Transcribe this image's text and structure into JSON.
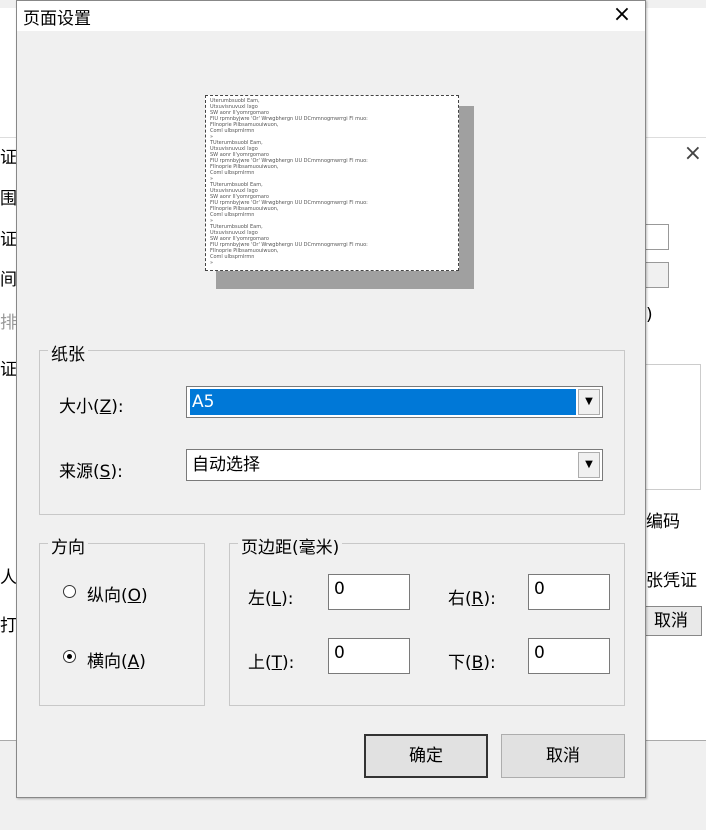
{
  "background_window": {
    "left_fragments": [
      "证",
      "围",
      "证",
      "间",
      "排",
      "证",
      "人",
      "打"
    ],
    "right_fragments": [
      ")",
      "编码",
      "张凭证"
    ],
    "cancel_label": "取消",
    "close_glyph": "×"
  },
  "dialog": {
    "title": "页面设置",
    "close_glyph": "×",
    "preview": {
      "lines": [
        "Uterumbsuobl Eam,",
        "Utxuvisnuvuxl Ixgo",
        "SW aonr Il'yomrgomaro",
        "FIU rpmnbyjwre 'Or' Wrwgbhergn UU DCmmnogmwrrgi Fl muo:",
        "FIlnoprie Pilbsamuouiwuon,",
        "Coml ulbsprnlrmn",
        "»",
        "TUterumbsuobl Eam,",
        "Utxuvisnuvuxl Ixgo",
        "SW aonr Il'yomrgomaro",
        "FIU rpmnbyjwre 'Or' Wrwgbhergn UU DCmmnogmwrrgi Fl muo:",
        "FIlnoprie Pilbsamuouiwuon,",
        "Coml ulbsprnlrmn",
        "»",
        "TUterumbsuobl Eam,",
        "Utxuvisnuvuxl Ixgo",
        "SW aonr Il'yomrgomaro",
        "FIU rpmnbyjwre 'Or' Wrwgbhergn UU DCmmnogmwrrgi Fl muo:",
        "FIlnoprie Pilbsamuouiwuon,",
        "Coml ulbsprnlrmn",
        "»",
        "TUterumbsuobl Eam,",
        "Utxuvisnuvuxl Ixgo",
        "SW aonr Il'yomrgomaro",
        "FIU rpmnbyjwre 'Or' Wrwgbhergn UU DCmmnogmwrrgi Fl muo:",
        "FIlnoprie Pilbsamuouiwuon,",
        "Coml ulbsprnlrmn",
        "»"
      ]
    },
    "paper": {
      "group_label": "纸张",
      "size_label_pre": "大小(",
      "size_label_key": "Z",
      "size_label_post": "):",
      "size_value": "A5",
      "source_label_pre": "来源(",
      "source_label_key": "S",
      "source_label_post": "):",
      "source_value": "自动选择"
    },
    "orientation": {
      "group_label": "方向",
      "portrait_pre": "纵向(",
      "portrait_key": "O",
      "portrait_post": ")",
      "landscape_pre": "横向(",
      "landscape_key": "A",
      "landscape_post": ")",
      "selected": "landscape"
    },
    "margins": {
      "group_label": "页边距(毫米)",
      "left_label_pre": "左(",
      "left_label_key": "L",
      "left_label_post": "):",
      "left_value": "0",
      "right_label_pre": "右(",
      "right_label_key": "R",
      "right_label_post": "):",
      "right_value": "0",
      "top_label_pre": "上(",
      "top_label_key": "T",
      "top_label_post": "):",
      "top_value": "0",
      "bottom_label_pre": "下(",
      "bottom_label_key": "B",
      "bottom_label_post": "):",
      "bottom_value": "0"
    },
    "ok_label": "确定",
    "cancel_label": "取消",
    "dropdown_glyph": "▼"
  },
  "colors": {
    "selection": "#0078d7",
    "dialog_bg": "#f0f0f0"
  }
}
